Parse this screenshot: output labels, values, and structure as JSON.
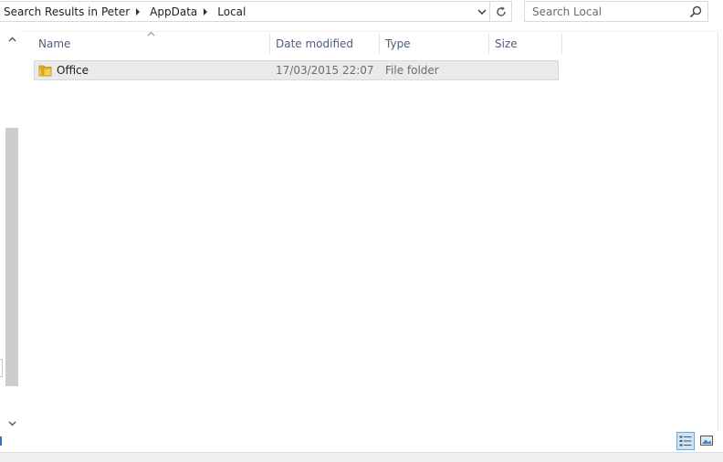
{
  "addressbar": {
    "crumbs": [
      "Search Results in Peter",
      "AppData",
      "Local"
    ]
  },
  "search": {
    "placeholder": "Search Local"
  },
  "columns": {
    "name": "Name",
    "date": "Date modified",
    "type": "Type",
    "size": "Size"
  },
  "rows": [
    {
      "name": "Office",
      "date": "17/03/2015 22:07",
      "type": "File folder",
      "size": ""
    }
  ],
  "icons": {
    "folder": "folder-icon",
    "refresh": "refresh-icon",
    "search": "search-icon",
    "details_view": "details-view-icon",
    "large_icons_view": "large-icons-view-icon"
  },
  "colors": {
    "header_text": "#4c607a",
    "selected_row": "#eaeaea",
    "folder": "#e8b923",
    "view_active": "#cce4f7"
  }
}
